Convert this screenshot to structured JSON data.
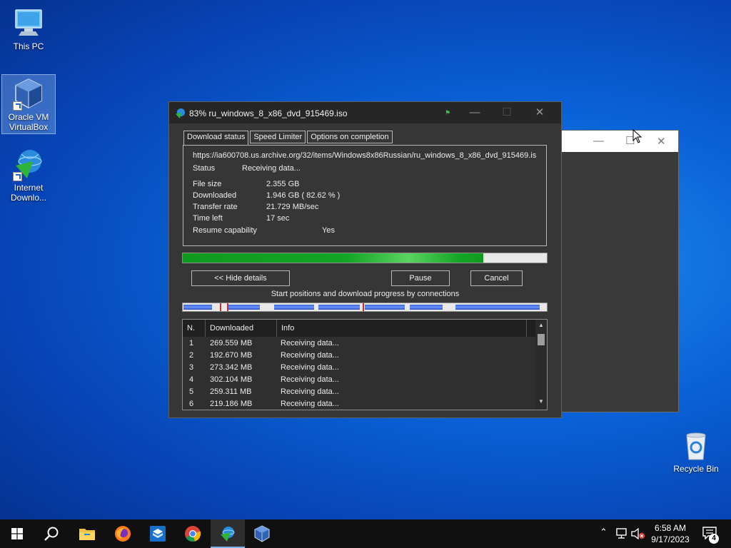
{
  "desktop": {
    "icons": [
      {
        "label": "This PC"
      },
      {
        "label": "Oracle VM VirtualBox"
      },
      {
        "label": "Internet Downlo..."
      },
      {
        "label": "Recycle Bin"
      }
    ]
  },
  "dialog": {
    "title": "83% ru_windows_8_x86_dvd_915469.iso",
    "tabs": [
      "Download status",
      "Speed Limiter",
      "Options on completion"
    ],
    "url": "https://ia600708.us.archive.org/32/items/Windows8x86Russian/ru_windows_8_x86_dvd_915469.is",
    "status_label": "Status",
    "status_value": "Receiving data...",
    "file_size_label": "File size",
    "file_size_value": "2.355  GB",
    "downloaded_label": "Downloaded",
    "downloaded_value": "1.946  GB  ( 82.62 % )",
    "transfer_rate_label": "Transfer rate",
    "transfer_rate_value": "21.729  MB/sec",
    "time_left_label": "Time left",
    "time_left_value": "17 sec",
    "resume_label": "Resume capability",
    "resume_value": "Yes",
    "progress_percent": 82.62,
    "hide_details_label": "<< Hide details",
    "pause_label": "Pause",
    "cancel_label": "Cancel",
    "connections_label": "Start positions and download progress by connections",
    "list_headers": [
      "N.",
      "Downloaded",
      "Info"
    ],
    "connections": [
      {
        "n": "1",
        "downloaded": "269.559  MB",
        "info": "Receiving data..."
      },
      {
        "n": "2",
        "downloaded": "192.670  MB",
        "info": "Receiving data..."
      },
      {
        "n": "3",
        "downloaded": "273.342  MB",
        "info": "Receiving data..."
      },
      {
        "n": "4",
        "downloaded": "302.104  MB",
        "info": "Receiving data..."
      },
      {
        "n": "5",
        "downloaded": "259.311  MB",
        "info": "Receiving data..."
      },
      {
        "n": "6",
        "downloaded": "219.186  MB",
        "info": "Receiving data..."
      }
    ]
  },
  "taskbar": {
    "time": "6:58 AM",
    "date": "9/17/2023",
    "notification_count": "4"
  },
  "colors": {
    "progress_green": "#14a524",
    "dialog_bg": "#363636",
    "taskbar_bg": "#101010"
  }
}
